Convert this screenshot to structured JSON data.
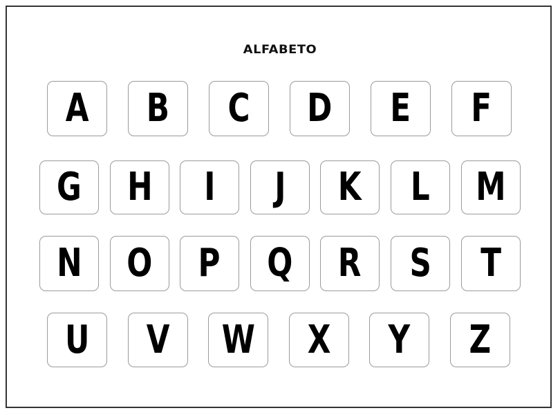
{
  "title": "ALFABETO",
  "rows": [
    [
      "A",
      "B",
      "C",
      "D",
      "E",
      "F"
    ],
    [
      "G",
      "H",
      "I",
      "J",
      "K",
      "L",
      "M"
    ],
    [
      "N",
      "O",
      "P",
      "Q",
      "R",
      "S",
      "T"
    ],
    [
      "U",
      "V",
      "W",
      "X",
      "Y",
      "Z"
    ]
  ]
}
